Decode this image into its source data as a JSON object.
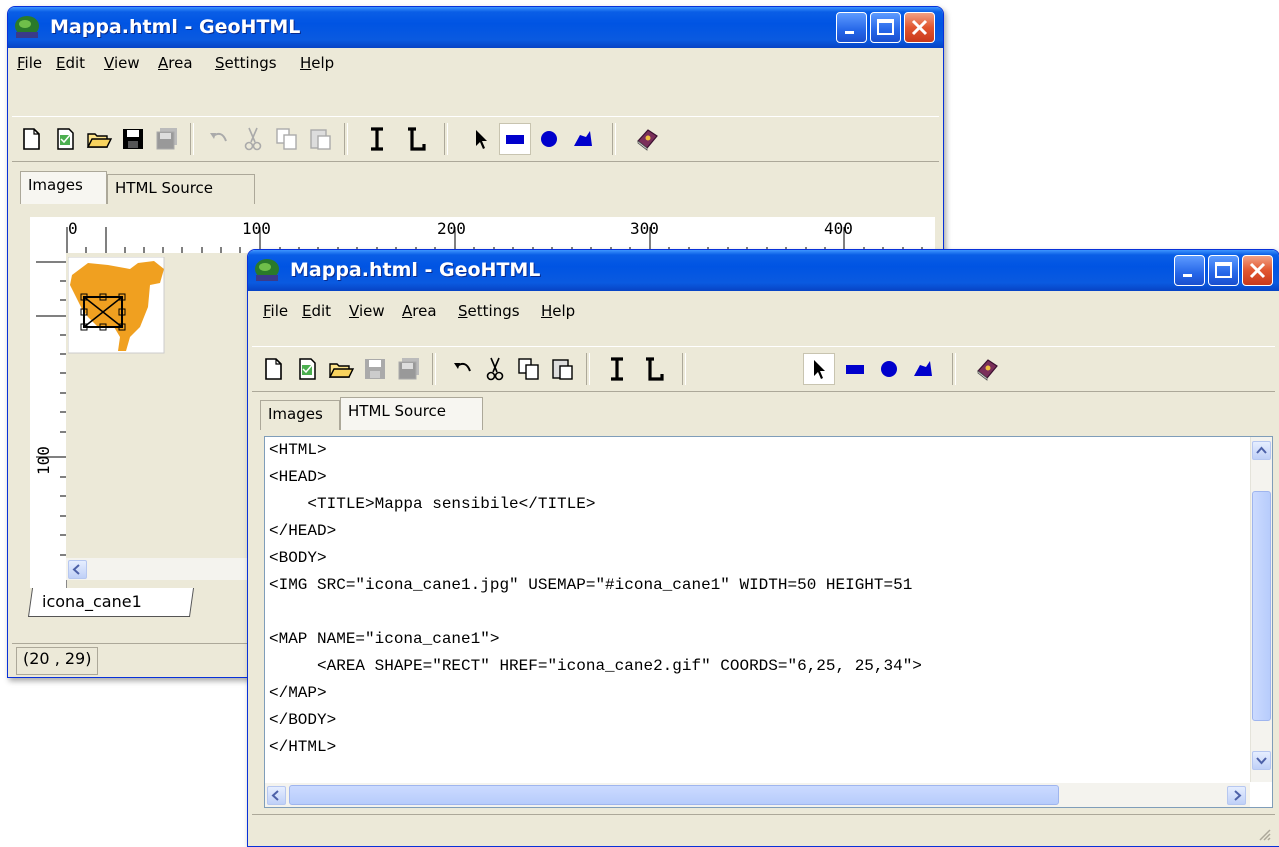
{
  "window_back": {
    "title": "Mappa.html - GeoHTML",
    "menu": [
      {
        "label": "File",
        "key": "F",
        "rest": "ile"
      },
      {
        "label": "Edit",
        "key": "E",
        "rest": "dit"
      },
      {
        "label": "View",
        "key": "V",
        "rest": "iew"
      },
      {
        "label": "Area",
        "key": "A",
        "rest": "rea"
      },
      {
        "label": "Settings",
        "key": "S",
        "rest": "ettings"
      },
      {
        "label": "Help",
        "key": "H",
        "rest": "elp"
      }
    ],
    "tabs": [
      "Images",
      "HTML Source"
    ],
    "active_tab": "Images",
    "ruler_top_labels": [
      "0",
      "100",
      "200",
      "300",
      "400"
    ],
    "ruler_left_labels": [
      "100"
    ],
    "image_tab": "icona_cane1",
    "status_coords": "(20 , 29)",
    "selected_tool": "rectangle"
  },
  "window_front": {
    "title": "Mappa.html - GeoHTML",
    "menu": [
      {
        "label": "File",
        "key": "F",
        "rest": "ile"
      },
      {
        "label": "Edit",
        "key": "E",
        "rest": "dit"
      },
      {
        "label": "View",
        "key": "V",
        "rest": "iew"
      },
      {
        "label": "Area",
        "key": "A",
        "rest": "rea"
      },
      {
        "label": "Settings",
        "key": "S",
        "rest": "ettings"
      },
      {
        "label": "Help",
        "key": "H",
        "rest": "elp"
      }
    ],
    "tabs": [
      "Images",
      "HTML Source"
    ],
    "active_tab": "HTML Source",
    "selected_tool": "pointer",
    "source_lines": [
      "<HTML>",
      "<HEAD>",
      "    <TITLE>Mappa sensibile</TITLE>",
      "</HEAD>",
      "<BODY>",
      "<IMG SRC=\"icona_cane1.jpg\" USEMAP=\"#icona_cane1\" WIDTH=50 HEIGHT=51",
      "",
      "<MAP NAME=\"icona_cane1\">",
      "     <AREA SHAPE=\"RECT\" HREF=\"icona_cane2.gif\" COORDS=\"6,25, 25,34\">",
      "</MAP>",
      "</BODY>",
      "</HTML>"
    ]
  },
  "colors": {
    "titlebar": "#0054e3",
    "window_face": "#ece9d8",
    "tool_blue": "#0000cc",
    "dog_orange": "#f0a020"
  },
  "icons": [
    "new-file-icon",
    "new-from-image-icon",
    "open-folder-icon",
    "save-icon",
    "save-all-icon",
    "undo-icon",
    "cut-icon",
    "copy-icon",
    "paste-icon",
    "text-i-icon",
    "text-l-icon",
    "pointer-icon",
    "rectangle-icon",
    "circle-icon",
    "polygon-icon",
    "help-book-icon"
  ]
}
